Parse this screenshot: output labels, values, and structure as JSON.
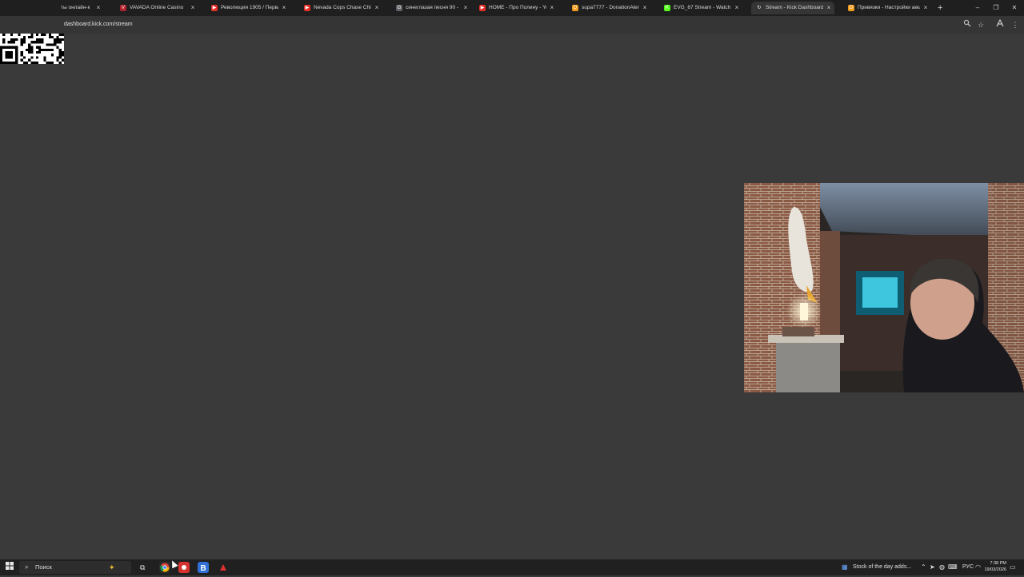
{
  "browser": {
    "tabs": [
      {
        "title": "ты онлайн-к",
        "fav": "",
        "fav_color": "#888888",
        "active": false
      },
      {
        "title": "VAVADA Online Casino",
        "fav": "V",
        "fav_color": "#b0212b",
        "active": false
      },
      {
        "title": "Революция 1905 / Первая р",
        "fav": "▶",
        "fav_color": "#e52d27",
        "active": false
      },
      {
        "title": "Nevada Cops Chase Child Pre",
        "fav": "▶",
        "fav_color": "#e52d27",
        "active": false
      },
      {
        "title": "синеглазая песня 90 - Googl",
        "fav": "G",
        "fav_color": "#5f6368",
        "active": false
      },
      {
        "title": "HOME - Про Полину - YouTu",
        "fav": "▶",
        "fav_color": "#e52d27",
        "active": false
      },
      {
        "title": "supa7777 - DonationAlerts",
        "fav": "D",
        "fav_color": "#f59c1a",
        "active": false
      },
      {
        "title": "EVG_67 Stream - Watch Live c",
        "fav": "K",
        "fav_color": "#53fc18",
        "active": false
      },
      {
        "title": "Stream - Kick Dashboard",
        "fav": "↻",
        "fav_color": "#353535",
        "active": true
      },
      {
        "title": "Привязки - Настройки аккау",
        "fav": "D",
        "fav_color": "#f59c1a",
        "active": false
      }
    ],
    "new_tab": "+",
    "window_controls": {
      "minimize": "–",
      "restore": "❐",
      "close": "✕"
    },
    "url": "dashboard.kick.com/stream",
    "toolbar_icons": [
      "zoom-icon",
      "bookmark-star-icon",
      "extensions-icon",
      "menu-dots-icon"
    ]
  },
  "taskbar": {
    "search_placeholder": "Поиск",
    "notification": "Stock of the day adds...",
    "language": "РУС",
    "time": "7:38 PM",
    "date": "19/03/2026"
  },
  "colors": {
    "page_bg": "#3a3a3a",
    "tabstrip_bg": "#1f1f1f",
    "taskbar_bg": "#202020",
    "kick_green": "#53fc18"
  }
}
